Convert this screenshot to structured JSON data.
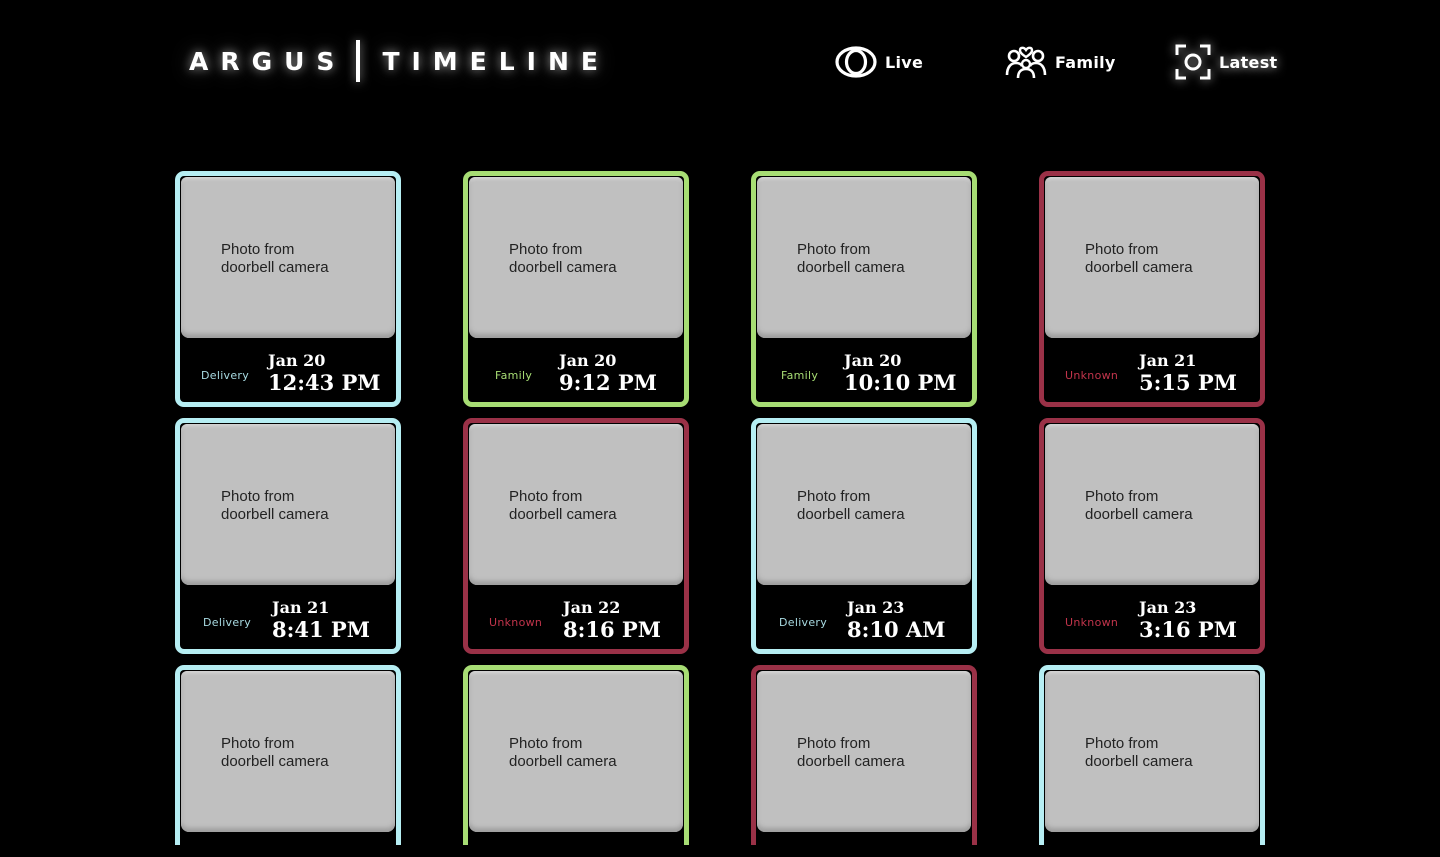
{
  "header": {
    "brand_left": "ARGUS",
    "brand_right": "TIMELINE"
  },
  "nav": {
    "live": {
      "label": "Live",
      "icon": "eye-icon"
    },
    "family": {
      "label": "Family",
      "icon": "family-icon"
    },
    "latest": {
      "label": "Latest",
      "icon": "camera-focus-icon",
      "active": true
    }
  },
  "colors": {
    "background": "#000000",
    "delivery": "#b6eef3",
    "family": "#a7dd74",
    "unknown": "#9a3147",
    "photo_placeholder": "#c0c0c0"
  },
  "cards": [
    {
      "category": "delivery",
      "type": "Delivery",
      "photo": "Photo from\ndoorbell camera",
      "date": "Jan 20",
      "time": "12:43 PM"
    },
    {
      "category": "family",
      "type": "Family",
      "photo": "Photo from\ndoorbell camera",
      "date": "Jan 20",
      "time": "9:12 PM"
    },
    {
      "category": "family",
      "type": "Family",
      "photo": "Photo from\ndoorbell camera",
      "date": "Jan 20",
      "time": "10:10 PM"
    },
    {
      "category": "unknown",
      "type": "Unknown",
      "photo": "Photo from\ndoorbell camera",
      "date": "Jan 21",
      "time": "5:15 PM"
    },
    {
      "category": "delivery",
      "type": "Delivery",
      "photo": "Photo from\ndoorbell camera",
      "date": "Jan 21",
      "time": "8:41 PM"
    },
    {
      "category": "unknown",
      "type": "Unknown",
      "photo": "Photo from\ndoorbell camera",
      "date": "Jan 22",
      "time": "8:16 PM"
    },
    {
      "category": "delivery",
      "type": "Delivery",
      "photo": "Photo from\ndoorbell camera",
      "date": "Jan 23",
      "time": "8:10 AM"
    },
    {
      "category": "unknown",
      "type": "Unknown",
      "photo": "Photo from\ndoorbell camera",
      "date": "Jan 23",
      "time": "3:16 PM"
    },
    {
      "category": "delivery",
      "photo": "Photo from\ndoorbell camera"
    },
    {
      "category": "family",
      "photo": "Photo from\ndoorbell camera"
    },
    {
      "category": "unknown",
      "photo": "Photo from\ndoorbell camera"
    },
    {
      "category": "delivery",
      "photo": "Photo from\ndoorbell camera"
    }
  ]
}
